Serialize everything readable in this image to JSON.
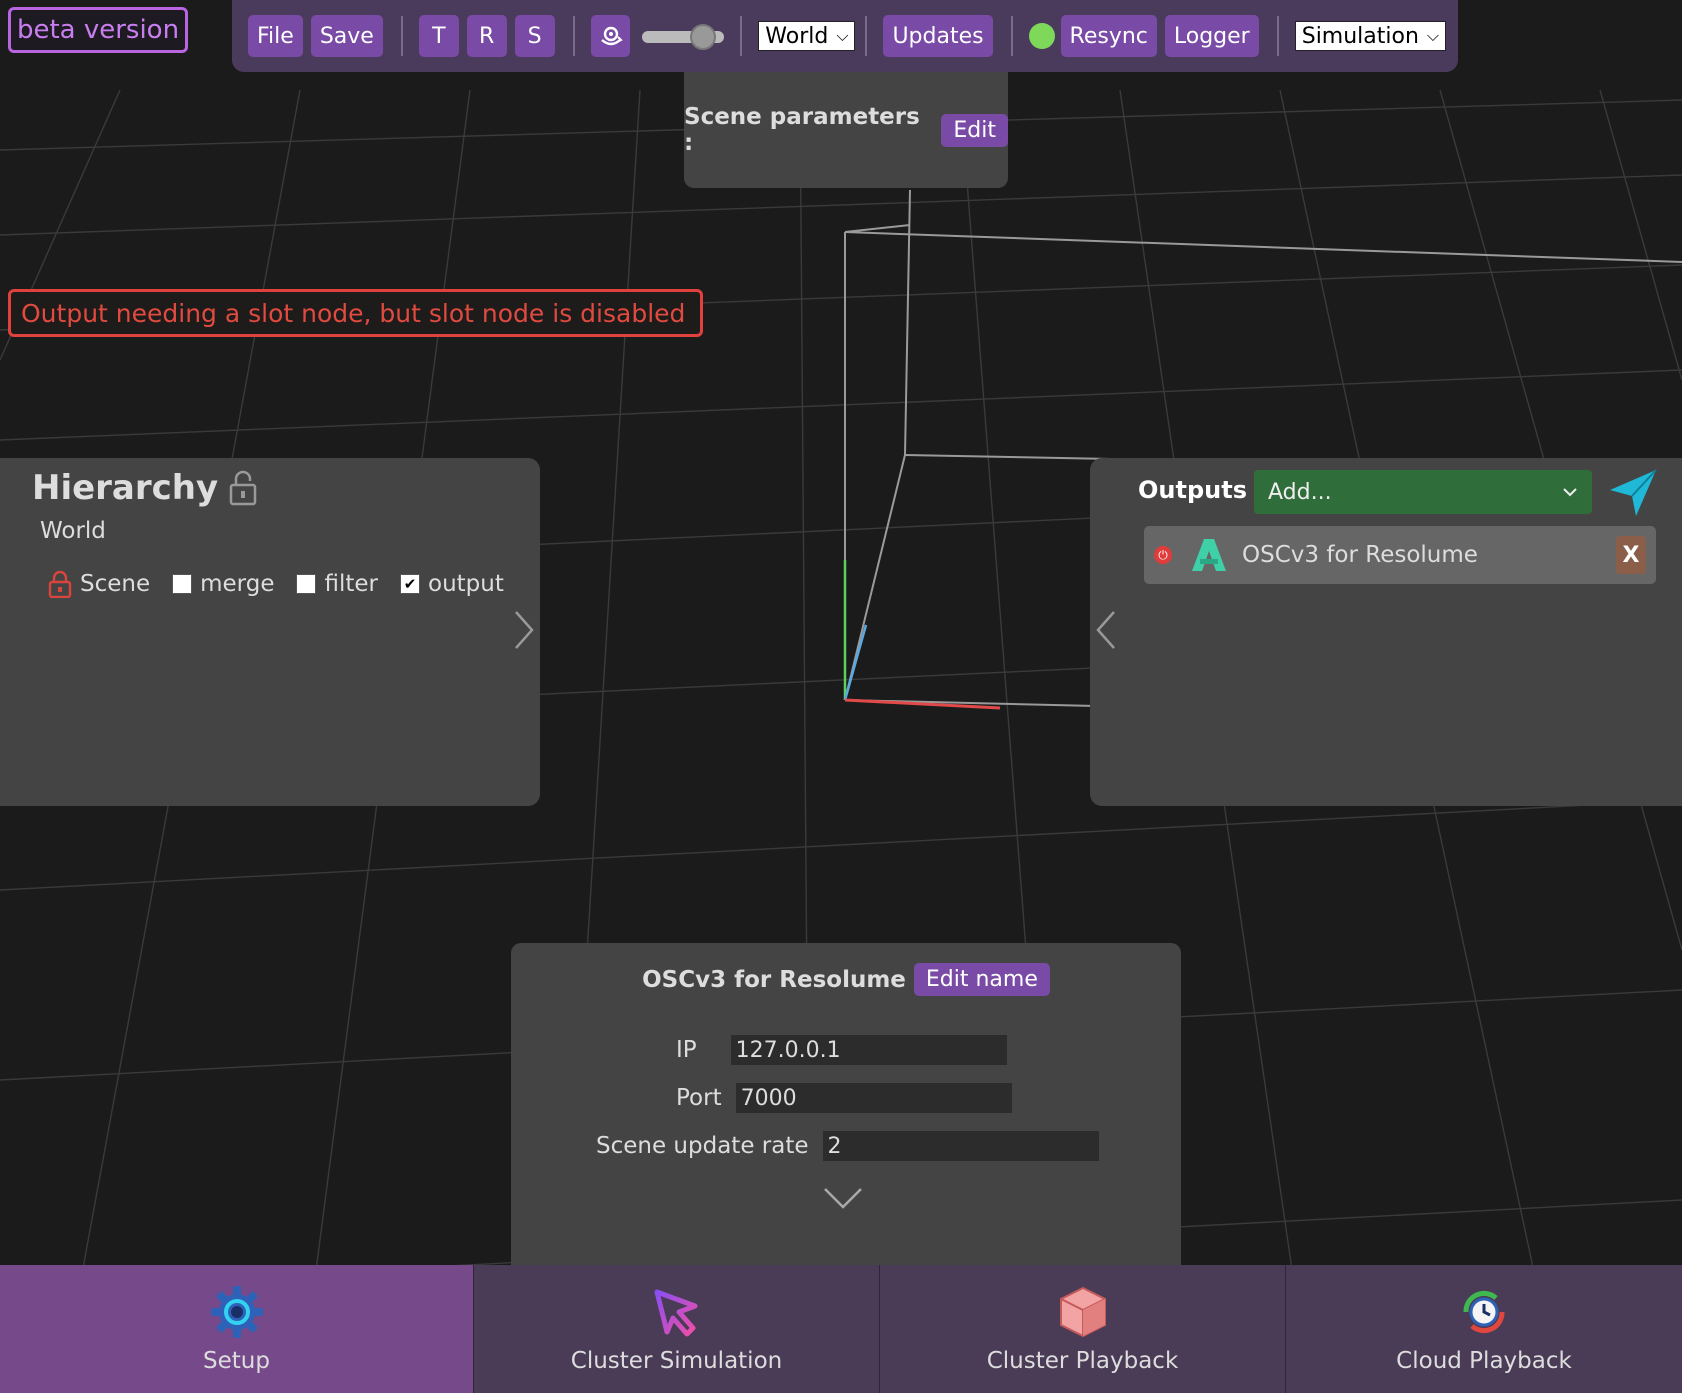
{
  "beta_badge": "beta version",
  "toolbar": {
    "file": "File",
    "save": "Save",
    "t": "T",
    "r": "R",
    "s": "S",
    "space_select": "World",
    "updates": "Updates",
    "status_color": "#7ed95b",
    "resync": "Resync",
    "logger": "Logger",
    "mode_select": "Simulation"
  },
  "scene_params": {
    "label": "Scene parameters :",
    "edit": "Edit"
  },
  "error_message": "Output needing a slot node, but slot node is disabled",
  "hierarchy": {
    "title": "Hierarchy",
    "world": "World",
    "scene": "Scene",
    "merge": {
      "label": "merge",
      "checked": false
    },
    "filter": {
      "label": "filter",
      "checked": false
    },
    "output": {
      "label": "output",
      "checked": true
    }
  },
  "outputs": {
    "title": "Outputs",
    "add_placeholder": "Add...",
    "items": [
      {
        "name": "OSCv3 for Resolume"
      }
    ],
    "remove_label": "X"
  },
  "detail": {
    "title": "OSCv3 for Resolume",
    "edit_name": "Edit name",
    "ip_label": "IP",
    "ip_value": "127.0.0.1",
    "port_label": "Port",
    "port_value": "7000",
    "rate_label": "Scene update rate",
    "rate_value": "2"
  },
  "nav": {
    "setup": "Setup",
    "cluster_simulation": "Cluster Simulation",
    "cluster_playback": "Cluster Playback",
    "cloud_playback": "Cloud Playback"
  },
  "colors": {
    "accent": "#7a4ba6",
    "toolbar_bg": "#4a3b5c",
    "error": "#e0413c",
    "panel_bg": "#444444"
  }
}
